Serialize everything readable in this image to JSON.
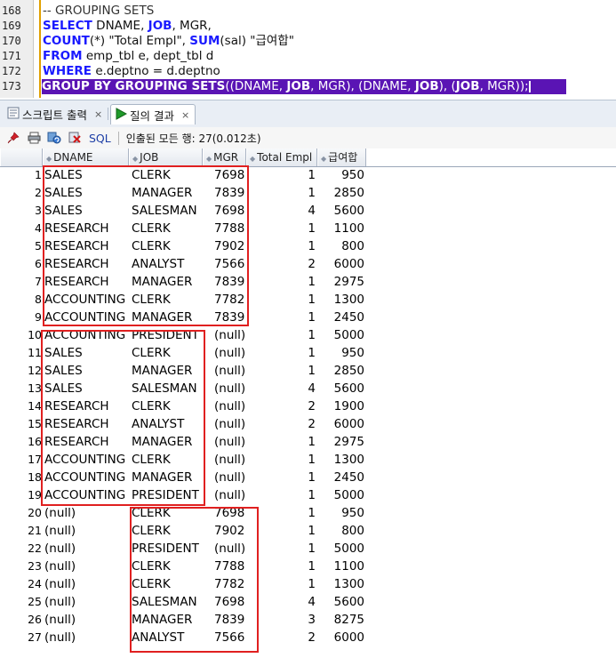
{
  "editor": {
    "line_numbers": [
      "168",
      "169",
      "170",
      "171",
      "172",
      "173"
    ],
    "lines": [
      {
        "parts": [
          {
            "t": "-- GROUPING SETS",
            "c": "cm"
          }
        ]
      },
      {
        "parts": [
          {
            "t": "SELECT",
            "c": "kw"
          },
          {
            "t": " DNAME, ",
            "c": ""
          },
          {
            "t": "JOB",
            "c": "kw"
          },
          {
            "t": ", MGR,",
            "c": ""
          }
        ]
      },
      {
        "parts": [
          {
            "t": "COUNT",
            "c": "kw"
          },
          {
            "t": "(*) \"Total Empl\", ",
            "c": ""
          },
          {
            "t": "SUM",
            "c": "kw"
          },
          {
            "t": "(sal) \"급여합\"",
            "c": ""
          }
        ]
      },
      {
        "parts": [
          {
            "t": "FROM",
            "c": "kw"
          },
          {
            "t": " emp_tbl e, dept_tbl d",
            "c": ""
          }
        ]
      },
      {
        "parts": [
          {
            "t": "WHERE",
            "c": "kw"
          },
          {
            "t": " e.deptno = d.deptno",
            "c": ""
          }
        ]
      },
      {
        "parts": [
          {
            "t": "GROUP BY GROUPING SETS",
            "c": "kw"
          },
          {
            "t": "((DNAME, ",
            "c": ""
          },
          {
            "t": "JOB",
            "c": "kw"
          },
          {
            "t": ", MGR), (DNAME, ",
            "c": ""
          },
          {
            "t": "JOB",
            "c": "kw"
          },
          {
            "t": "), (",
            "c": ""
          },
          {
            "t": "JOB",
            "c": "kw"
          },
          {
            "t": ", MGR));",
            "c": ""
          }
        ],
        "selected": true
      }
    ]
  },
  "tabs": {
    "script_output": "스크립트 출력",
    "query_result": "질의 결과",
    "close_glyph": "×"
  },
  "toolbar": {
    "sql_label": "SQL",
    "status": "인출된 모든 행: 27(0.012초)"
  },
  "grid": {
    "columns": [
      "DNAME",
      "JOB",
      "MGR",
      "Total Empl",
      "급여합"
    ],
    "rows": [
      [
        "1",
        "SALES",
        "CLERK",
        "7698",
        "1",
        "950"
      ],
      [
        "2",
        "SALES",
        "MANAGER",
        "7839",
        "1",
        "2850"
      ],
      [
        "3",
        "SALES",
        "SALESMAN",
        "7698",
        "4",
        "5600"
      ],
      [
        "4",
        "RESEARCH",
        "CLERK",
        "7788",
        "1",
        "1100"
      ],
      [
        "5",
        "RESEARCH",
        "CLERK",
        "7902",
        "1",
        "800"
      ],
      [
        "6",
        "RESEARCH",
        "ANALYST",
        "7566",
        "2",
        "6000"
      ],
      [
        "7",
        "RESEARCH",
        "MANAGER",
        "7839",
        "1",
        "2975"
      ],
      [
        "8",
        "ACCOUNTING",
        "CLERK",
        "7782",
        "1",
        "1300"
      ],
      [
        "9",
        "ACCOUNTING",
        "MANAGER",
        "7839",
        "1",
        "2450"
      ],
      [
        "10",
        "ACCOUNTING",
        "PRESIDENT",
        "(null)",
        "1",
        "5000"
      ],
      [
        "11",
        "SALES",
        "CLERK",
        "(null)",
        "1",
        "950"
      ],
      [
        "12",
        "SALES",
        "MANAGER",
        "(null)",
        "1",
        "2850"
      ],
      [
        "13",
        "SALES",
        "SALESMAN",
        "(null)",
        "4",
        "5600"
      ],
      [
        "14",
        "RESEARCH",
        "CLERK",
        "(null)",
        "2",
        "1900"
      ],
      [
        "15",
        "RESEARCH",
        "ANALYST",
        "(null)",
        "2",
        "6000"
      ],
      [
        "16",
        "RESEARCH",
        "MANAGER",
        "(null)",
        "1",
        "2975"
      ],
      [
        "17",
        "ACCOUNTING",
        "CLERK",
        "(null)",
        "1",
        "1300"
      ],
      [
        "18",
        "ACCOUNTING",
        "MANAGER",
        "(null)",
        "1",
        "2450"
      ],
      [
        "19",
        "ACCOUNTING",
        "PRESIDENT",
        "(null)",
        "1",
        "5000"
      ],
      [
        "20",
        "(null)",
        "CLERK",
        "7698",
        "1",
        "950"
      ],
      [
        "21",
        "(null)",
        "CLERK",
        "7902",
        "1",
        "800"
      ],
      [
        "22",
        "(null)",
        "PRESIDENT",
        "(null)",
        "1",
        "5000"
      ],
      [
        "23",
        "(null)",
        "CLERK",
        "7788",
        "1",
        "1100"
      ],
      [
        "24",
        "(null)",
        "CLERK",
        "7782",
        "1",
        "1300"
      ],
      [
        "25",
        "(null)",
        "SALESMAN",
        "7698",
        "4",
        "5600"
      ],
      [
        "26",
        "(null)",
        "MANAGER",
        "7839",
        "3",
        "8275"
      ],
      [
        "27",
        "(null)",
        "ANALYST",
        "7566",
        "2",
        "6000"
      ]
    ]
  },
  "colors": {
    "keyword": "#1a1aff",
    "selection": "#5a14b4",
    "highlight_box": "#e02020"
  }
}
